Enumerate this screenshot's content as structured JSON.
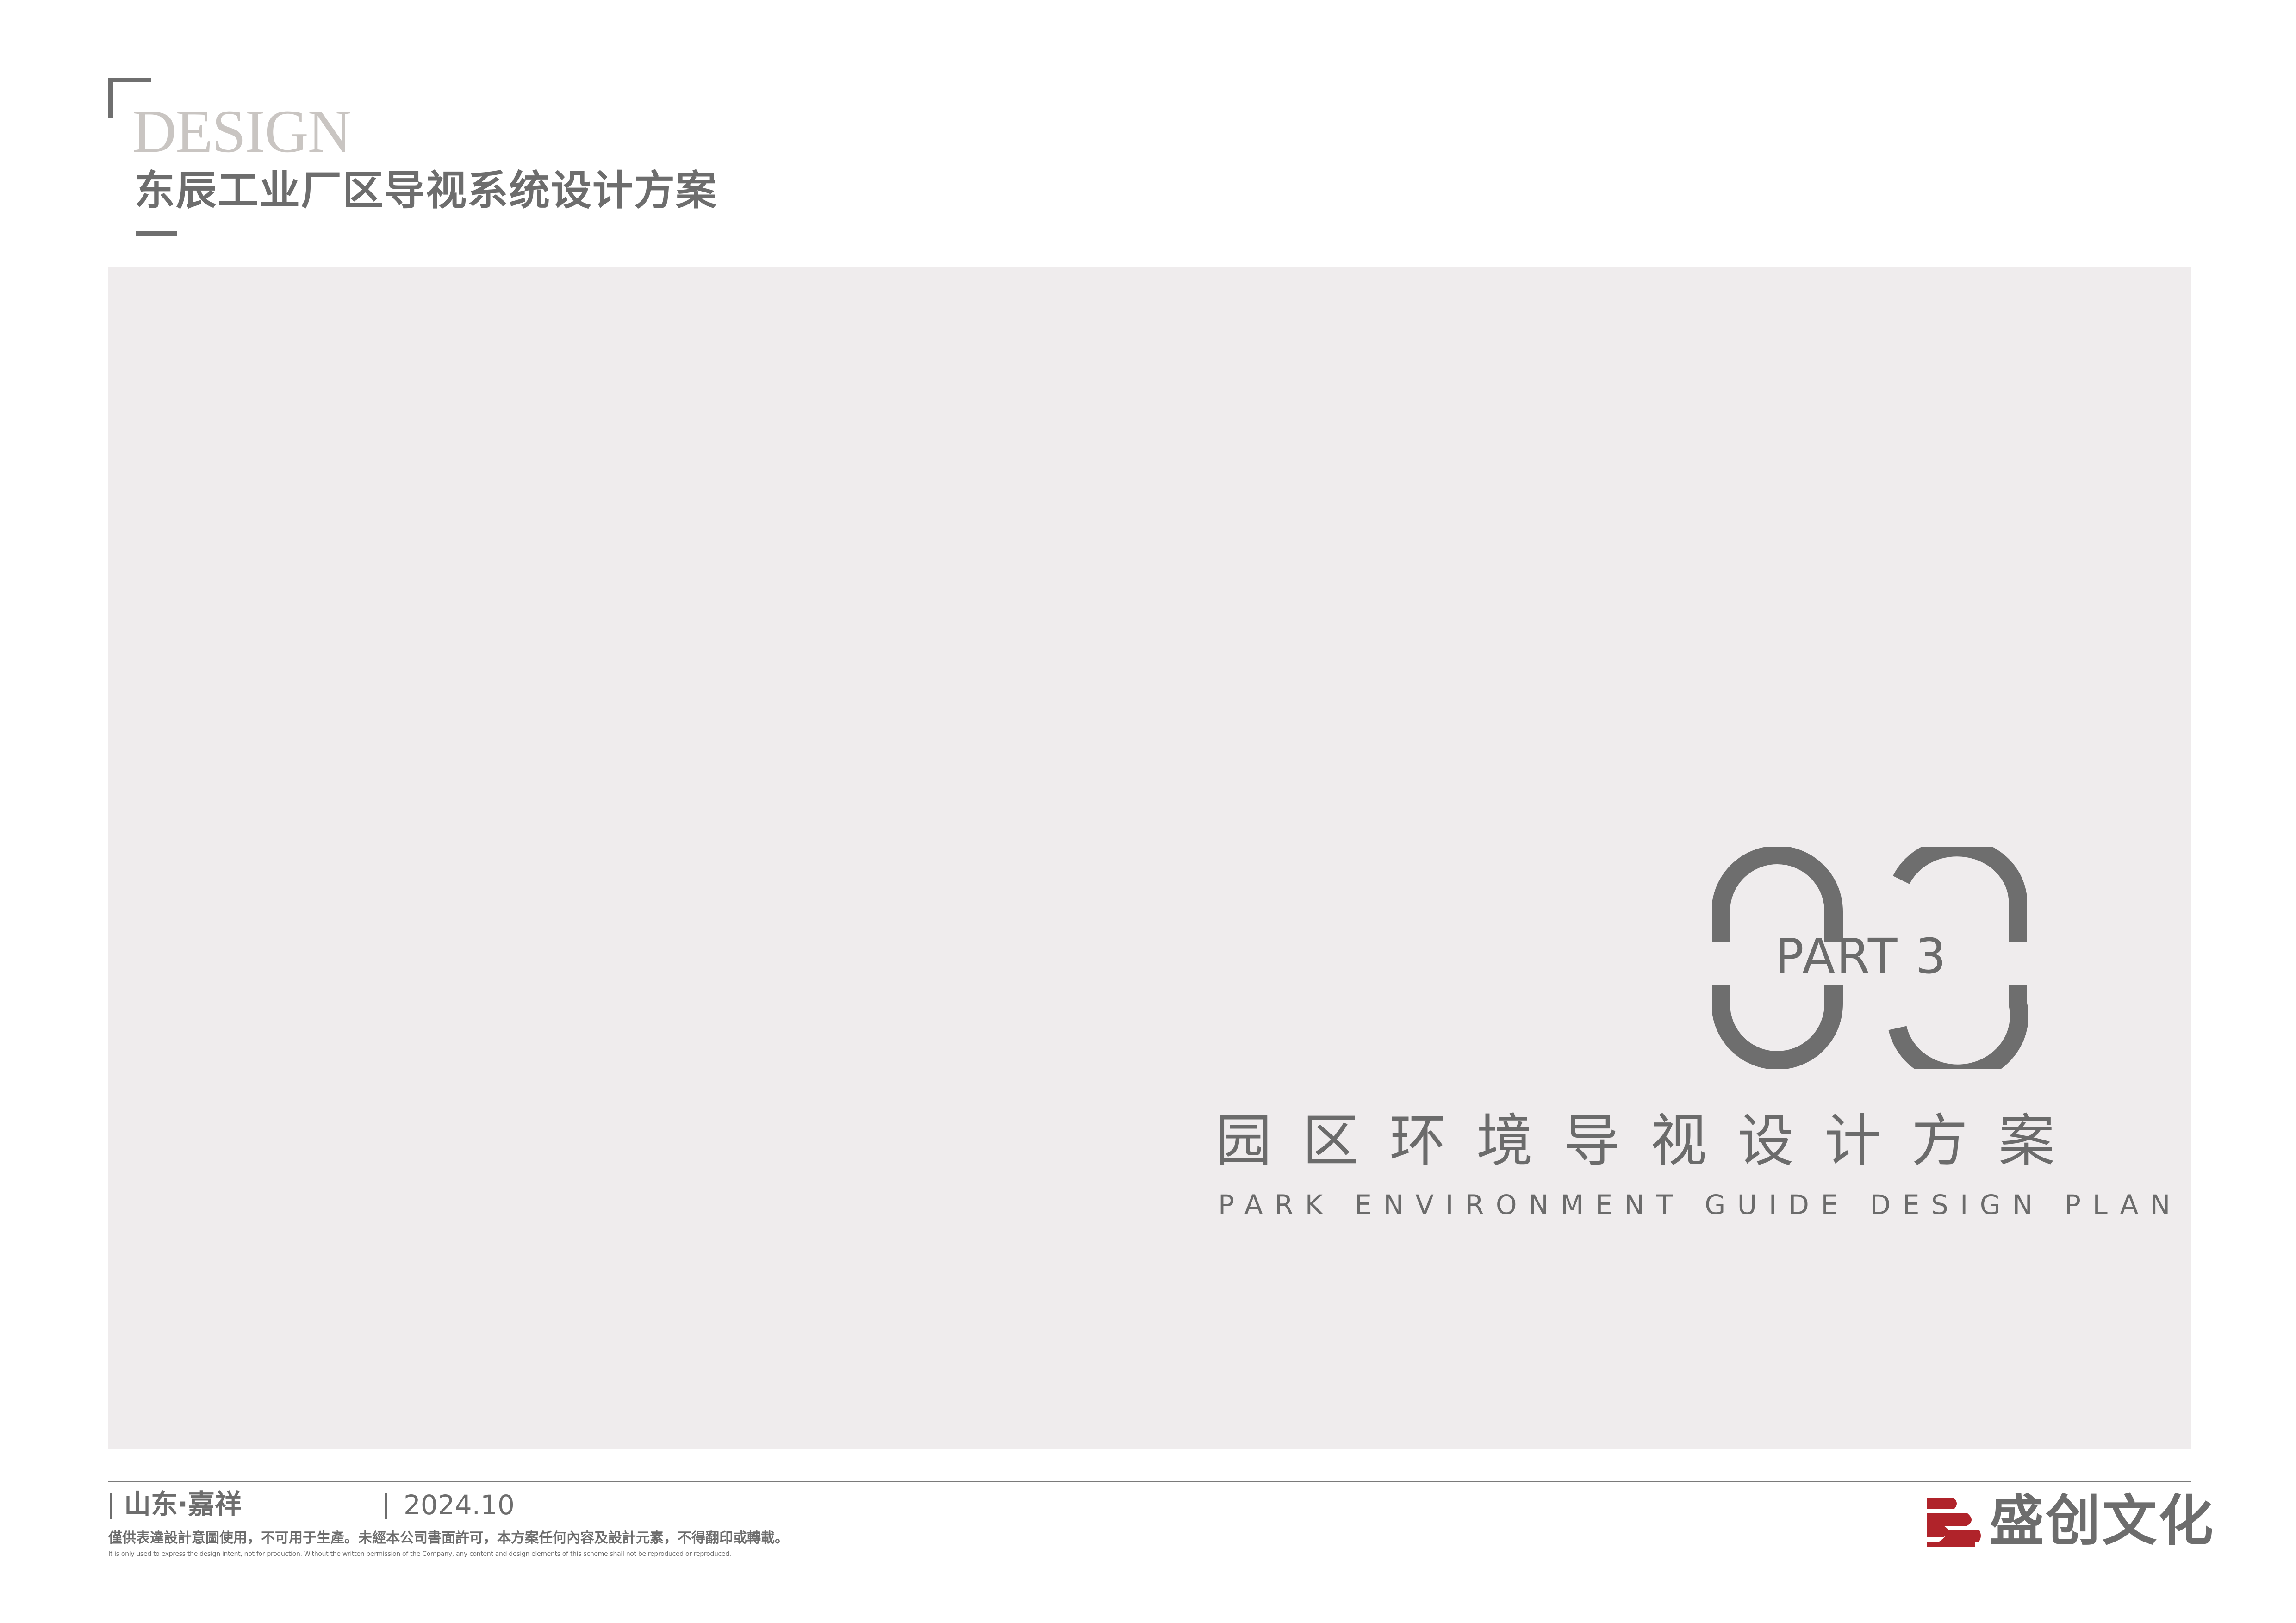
{
  "header": {
    "label": "DESIGN",
    "title": "东辰工业厂区导视系统设计方案"
  },
  "section": {
    "number": "03",
    "part_label": "PART 3",
    "title_cn": "园区环境导视设计方案",
    "title_en": "PARK ENVIRONMENT GUIDE DESIGN PLAN"
  },
  "footer": {
    "location": "山东·嘉祥",
    "date": "2024.10",
    "disclaimer_cn": "僅供表達設計意圖使用，不可用于生產。未經本公司書面許可，本方案任何內容及設計元素，不得翻印或轉載。",
    "disclaimer_en": "It is only used to express the design intent, not for production. Without the written permission of the Company, any content and design elements of this scheme shall not be reproduced or reproduced."
  },
  "brand": {
    "name": "盛创文化",
    "logo_icon": "flag-logo-icon",
    "logo_color": "#b0232a"
  },
  "colors": {
    "panel": "#efeced",
    "text": "#6d6d6d",
    "design_word": "#c9c5c2"
  }
}
